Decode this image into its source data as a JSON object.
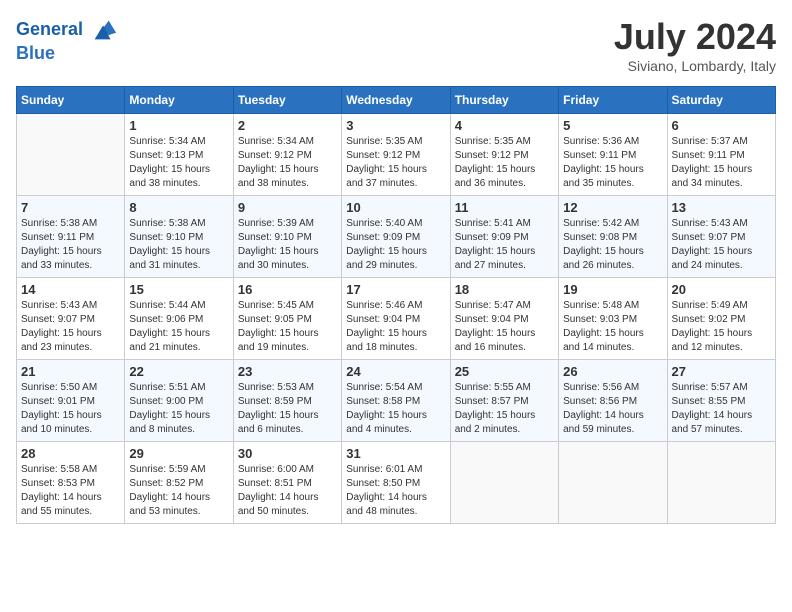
{
  "header": {
    "logo_line1": "General",
    "logo_line2": "Blue",
    "month": "July 2024",
    "location": "Siviano, Lombardy, Italy"
  },
  "days_of_week": [
    "Sunday",
    "Monday",
    "Tuesday",
    "Wednesday",
    "Thursday",
    "Friday",
    "Saturday"
  ],
  "weeks": [
    [
      {
        "day": "",
        "info": ""
      },
      {
        "day": "1",
        "info": "Sunrise: 5:34 AM\nSunset: 9:13 PM\nDaylight: 15 hours\nand 38 minutes."
      },
      {
        "day": "2",
        "info": "Sunrise: 5:34 AM\nSunset: 9:12 PM\nDaylight: 15 hours\nand 38 minutes."
      },
      {
        "day": "3",
        "info": "Sunrise: 5:35 AM\nSunset: 9:12 PM\nDaylight: 15 hours\nand 37 minutes."
      },
      {
        "day": "4",
        "info": "Sunrise: 5:35 AM\nSunset: 9:12 PM\nDaylight: 15 hours\nand 36 minutes."
      },
      {
        "day": "5",
        "info": "Sunrise: 5:36 AM\nSunset: 9:11 PM\nDaylight: 15 hours\nand 35 minutes."
      },
      {
        "day": "6",
        "info": "Sunrise: 5:37 AM\nSunset: 9:11 PM\nDaylight: 15 hours\nand 34 minutes."
      }
    ],
    [
      {
        "day": "7",
        "info": "Sunrise: 5:38 AM\nSunset: 9:11 PM\nDaylight: 15 hours\nand 33 minutes."
      },
      {
        "day": "8",
        "info": "Sunrise: 5:38 AM\nSunset: 9:10 PM\nDaylight: 15 hours\nand 31 minutes."
      },
      {
        "day": "9",
        "info": "Sunrise: 5:39 AM\nSunset: 9:10 PM\nDaylight: 15 hours\nand 30 minutes."
      },
      {
        "day": "10",
        "info": "Sunrise: 5:40 AM\nSunset: 9:09 PM\nDaylight: 15 hours\nand 29 minutes."
      },
      {
        "day": "11",
        "info": "Sunrise: 5:41 AM\nSunset: 9:09 PM\nDaylight: 15 hours\nand 27 minutes."
      },
      {
        "day": "12",
        "info": "Sunrise: 5:42 AM\nSunset: 9:08 PM\nDaylight: 15 hours\nand 26 minutes."
      },
      {
        "day": "13",
        "info": "Sunrise: 5:43 AM\nSunset: 9:07 PM\nDaylight: 15 hours\nand 24 minutes."
      }
    ],
    [
      {
        "day": "14",
        "info": "Sunrise: 5:43 AM\nSunset: 9:07 PM\nDaylight: 15 hours\nand 23 minutes."
      },
      {
        "day": "15",
        "info": "Sunrise: 5:44 AM\nSunset: 9:06 PM\nDaylight: 15 hours\nand 21 minutes."
      },
      {
        "day": "16",
        "info": "Sunrise: 5:45 AM\nSunset: 9:05 PM\nDaylight: 15 hours\nand 19 minutes."
      },
      {
        "day": "17",
        "info": "Sunrise: 5:46 AM\nSunset: 9:04 PM\nDaylight: 15 hours\nand 18 minutes."
      },
      {
        "day": "18",
        "info": "Sunrise: 5:47 AM\nSunset: 9:04 PM\nDaylight: 15 hours\nand 16 minutes."
      },
      {
        "day": "19",
        "info": "Sunrise: 5:48 AM\nSunset: 9:03 PM\nDaylight: 15 hours\nand 14 minutes."
      },
      {
        "day": "20",
        "info": "Sunrise: 5:49 AM\nSunset: 9:02 PM\nDaylight: 15 hours\nand 12 minutes."
      }
    ],
    [
      {
        "day": "21",
        "info": "Sunrise: 5:50 AM\nSunset: 9:01 PM\nDaylight: 15 hours\nand 10 minutes."
      },
      {
        "day": "22",
        "info": "Sunrise: 5:51 AM\nSunset: 9:00 PM\nDaylight: 15 hours\nand 8 minutes."
      },
      {
        "day": "23",
        "info": "Sunrise: 5:53 AM\nSunset: 8:59 PM\nDaylight: 15 hours\nand 6 minutes."
      },
      {
        "day": "24",
        "info": "Sunrise: 5:54 AM\nSunset: 8:58 PM\nDaylight: 15 hours\nand 4 minutes."
      },
      {
        "day": "25",
        "info": "Sunrise: 5:55 AM\nSunset: 8:57 PM\nDaylight: 15 hours\nand 2 minutes."
      },
      {
        "day": "26",
        "info": "Sunrise: 5:56 AM\nSunset: 8:56 PM\nDaylight: 14 hours\nand 59 minutes."
      },
      {
        "day": "27",
        "info": "Sunrise: 5:57 AM\nSunset: 8:55 PM\nDaylight: 14 hours\nand 57 minutes."
      }
    ],
    [
      {
        "day": "28",
        "info": "Sunrise: 5:58 AM\nSunset: 8:53 PM\nDaylight: 14 hours\nand 55 minutes."
      },
      {
        "day": "29",
        "info": "Sunrise: 5:59 AM\nSunset: 8:52 PM\nDaylight: 14 hours\nand 53 minutes."
      },
      {
        "day": "30",
        "info": "Sunrise: 6:00 AM\nSunset: 8:51 PM\nDaylight: 14 hours\nand 50 minutes."
      },
      {
        "day": "31",
        "info": "Sunrise: 6:01 AM\nSunset: 8:50 PM\nDaylight: 14 hours\nand 48 minutes."
      },
      {
        "day": "",
        "info": ""
      },
      {
        "day": "",
        "info": ""
      },
      {
        "day": "",
        "info": ""
      }
    ]
  ]
}
